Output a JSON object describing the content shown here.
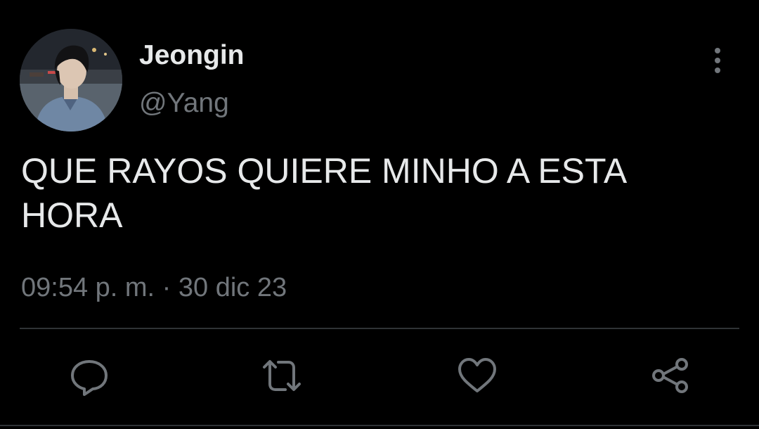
{
  "tweet": {
    "author": {
      "display_name": "Jeongin",
      "handle": "@Yang"
    },
    "text": "QUE RAYOS QUIERE MINHO A ESTA HORA",
    "timestamp": "09:54 p. m. · 30 dic 23"
  },
  "actions": {
    "more_icon": "more-vertical-icon",
    "reply_icon": "reply-icon",
    "retweet_icon": "retweet-icon",
    "like_icon": "heart-icon",
    "share_icon": "share-icon"
  },
  "colors": {
    "background": "#000000",
    "primary_text": "#e7e9ea",
    "secondary_text": "#71767b",
    "divider": "#2f3336"
  }
}
